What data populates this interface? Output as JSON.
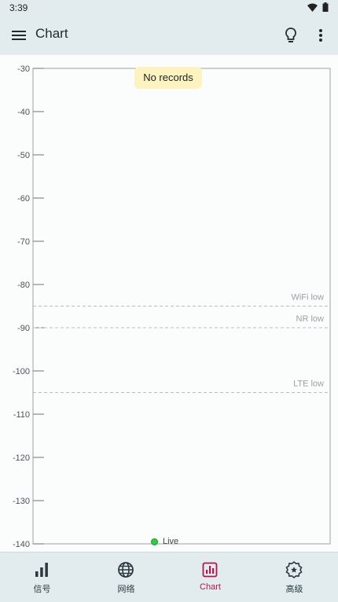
{
  "status_bar": {
    "time": "3:39"
  },
  "app_bar": {
    "title": "Chart"
  },
  "chart": {
    "no_records": "No records",
    "live_label": "Live",
    "y_ticks": [
      "-30",
      "-40",
      "-50",
      "-60",
      "-70",
      "-80",
      "-90",
      "-100",
      "-110",
      "-120",
      "-130",
      "-140"
    ],
    "thresholds": [
      {
        "label": "WiFi low",
        "value": -85
      },
      {
        "label": "NR low",
        "value": -90
      },
      {
        "label": "LTE low",
        "value": -105
      }
    ]
  },
  "chart_data": {
    "type": "line",
    "series": [],
    "ylim": [
      -140,
      -30
    ],
    "yticks": [
      -30,
      -40,
      -50,
      -60,
      -70,
      -80,
      -90,
      -100,
      -110,
      -120,
      -130,
      -140
    ],
    "reference_lines": [
      {
        "label": "WiFi low",
        "y": -85
      },
      {
        "label": "NR low",
        "y": -90
      },
      {
        "label": "LTE low",
        "y": -105
      }
    ],
    "annotation": "No records",
    "legend": [
      {
        "name": "Live",
        "color": "#2ecc40"
      }
    ]
  },
  "nav": {
    "items": [
      {
        "label": "信号",
        "icon": "signal-bars-icon"
      },
      {
        "label": "网络",
        "icon": "globe-icon"
      },
      {
        "label": "Chart",
        "icon": "chart-icon",
        "active": true
      },
      {
        "label": "高级",
        "icon": "advanced-badge-icon"
      }
    ]
  },
  "colors": {
    "active": "#b0174d",
    "bar": "#e2ecef",
    "threshold": "#bdbdbd",
    "live": "#2ecc40"
  }
}
